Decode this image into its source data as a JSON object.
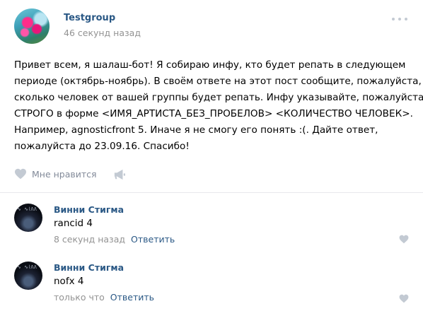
{
  "post": {
    "group_name": "Testgroup",
    "time": "46 секунд назад",
    "text_lines": [
      "Привет всем, я шалаш-бот! Я собираю инфу, кто будет репать в следующем",
      "периоде (октябрь-ноябрь). В своём ответе на этот пост сообщите, пожалуйста,",
      "сколько человек от вашей группы будет репать. Инфу указывайте, пожалуйста,",
      "СТРОГО в форме <ИМЯ_АРТИСТА_БЕЗ_ПРОБЕЛОВ> <КОЛИЧЕСТВО ЧЕЛОВЕК>.",
      "Например, agnosticfront 5. Иначе я не смогу его понять :(. Дайте ответ,",
      "пожалуйста до 23.09.16. Спасибо!"
    ],
    "like_label": "Мне нравится"
  },
  "comments": [
    {
      "author": "Винни Стигма",
      "text": "rancid 4",
      "time": "8 секунд назад",
      "reply_label": "Ответить"
    },
    {
      "author": "Винни Стигма",
      "text": "nofx 4",
      "time": "только что",
      "reply_label": "Ответить"
    }
  ],
  "colors": {
    "link": "#2a5885",
    "meta": "#939393",
    "icon": "#c3cad3"
  }
}
